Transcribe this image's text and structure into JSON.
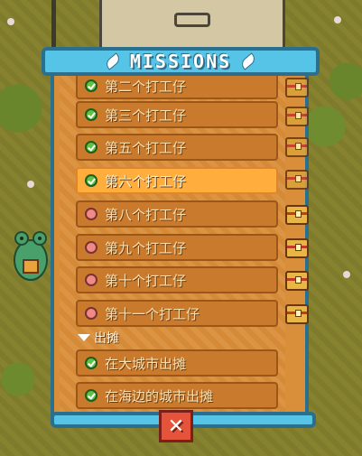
{
  "header": {
    "title": "MISSIONS"
  },
  "missions": [
    {
      "label": "第二个打工仔",
      "done": true
    },
    {
      "label": "第三个打工仔",
      "done": true
    },
    {
      "label": "第五个打工仔",
      "done": true
    },
    {
      "label": "第六个打工仔",
      "done": true,
      "highlight": true
    },
    {
      "label": "第八个打工仔",
      "done": false
    },
    {
      "label": "第九个打工仔",
      "done": false
    },
    {
      "label": "第十个打工仔",
      "done": false
    },
    {
      "label": "第十一个打工仔",
      "done": false
    }
  ],
  "section": {
    "label": "出摊"
  },
  "section_missions": [
    {
      "label": "在大城市出摊",
      "done": true
    },
    {
      "label": "在海边的城市出摊",
      "done": true
    }
  ],
  "close": {
    "symbol": "✕"
  },
  "colors": {
    "frame": "#2b6f8e",
    "header": "#55c4e6",
    "row": "#c97a2c",
    "row_highlight": "#ffad3d",
    "close": "#e5543a"
  }
}
